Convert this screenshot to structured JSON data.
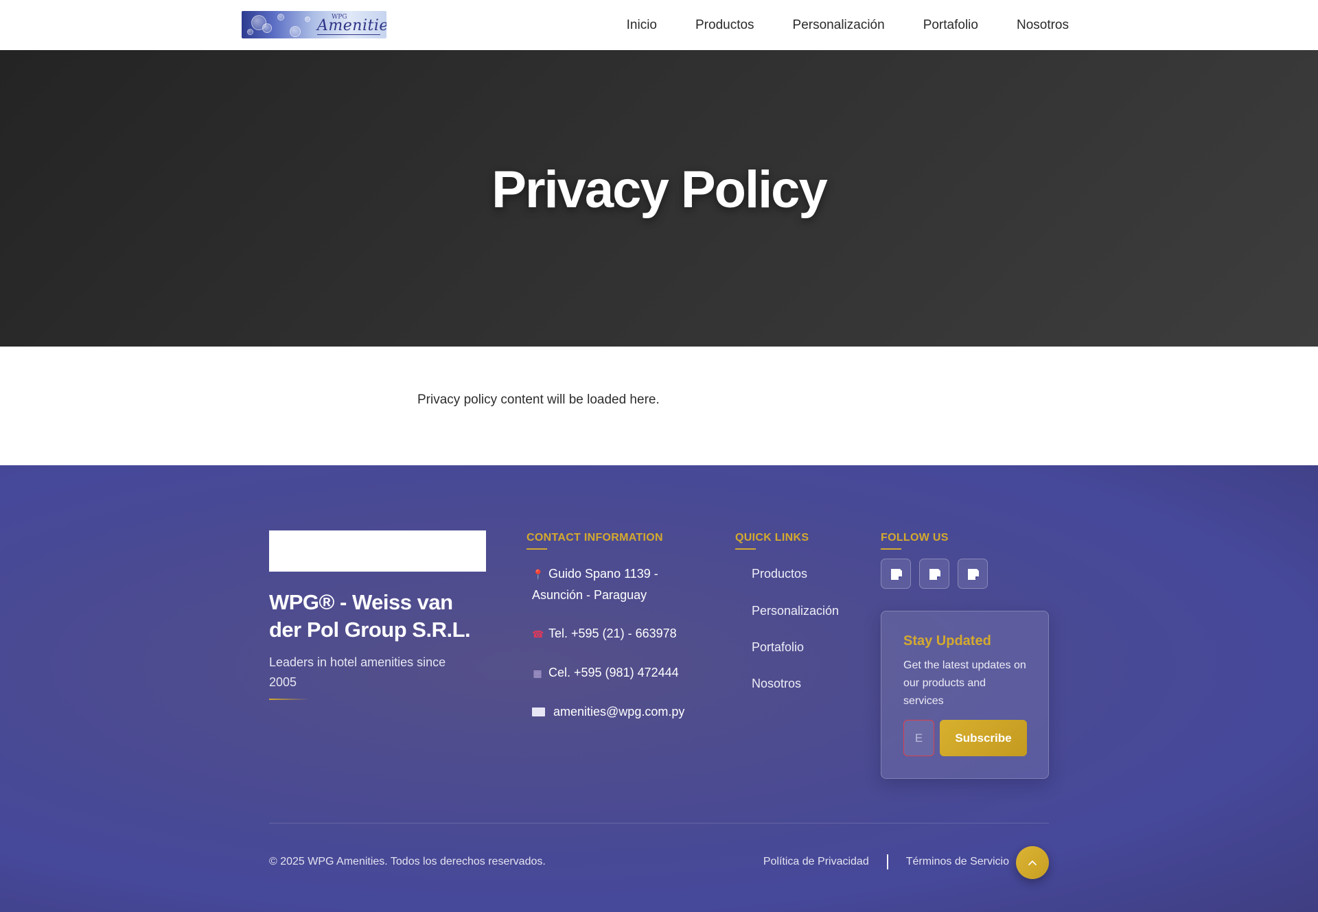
{
  "header": {
    "logo": {
      "small_text": "WPG",
      "text": "Amenities"
    },
    "nav": [
      {
        "label": "Inicio"
      },
      {
        "label": "Productos"
      },
      {
        "label": "Personalización"
      },
      {
        "label": "Portafolio"
      },
      {
        "label": "Nosotros"
      }
    ]
  },
  "hero": {
    "title": "Privacy Policy"
  },
  "content": {
    "text": "Privacy policy content will be loaded here."
  },
  "footer": {
    "company": "WPG® - Weiss van der Pol Group S.R.L.",
    "tagline": "Leaders in hotel amenities since 2005",
    "contact": {
      "title": "CONTACT INFORMATION",
      "address": "Guido Spano 1139 - Asunción - Paraguay",
      "phone": "Tel. +595 (21) - 663978",
      "mobile": "Cel. +595 (981) 472444",
      "email": "amenities@wpg.com.py"
    },
    "quick_links": {
      "title": "QUICK LINKS",
      "items": [
        {
          "label": "Productos"
        },
        {
          "label": "Personalización"
        },
        {
          "label": "Portafolio"
        },
        {
          "label": "Nosotros"
        }
      ]
    },
    "follow": {
      "title": "FOLLOW US",
      "icons": [
        "social-icon-1",
        "social-icon-2",
        "social-icon-3"
      ]
    },
    "newsletter": {
      "title": "Stay Updated",
      "text": "Get the latest updates on our products and services",
      "input_placeholder": "E",
      "button": "Subscribe"
    },
    "copyright": "© 2025 WPG Amenities. Todos los derechos reservados.",
    "legal": {
      "privacy": "Política de Privacidad",
      "terms": "Términos de Servicio"
    }
  },
  "colors": {
    "accent_gold": "#d4aa2e",
    "footer_bg": "#4a4a93",
    "hero_bg": "#303030"
  }
}
